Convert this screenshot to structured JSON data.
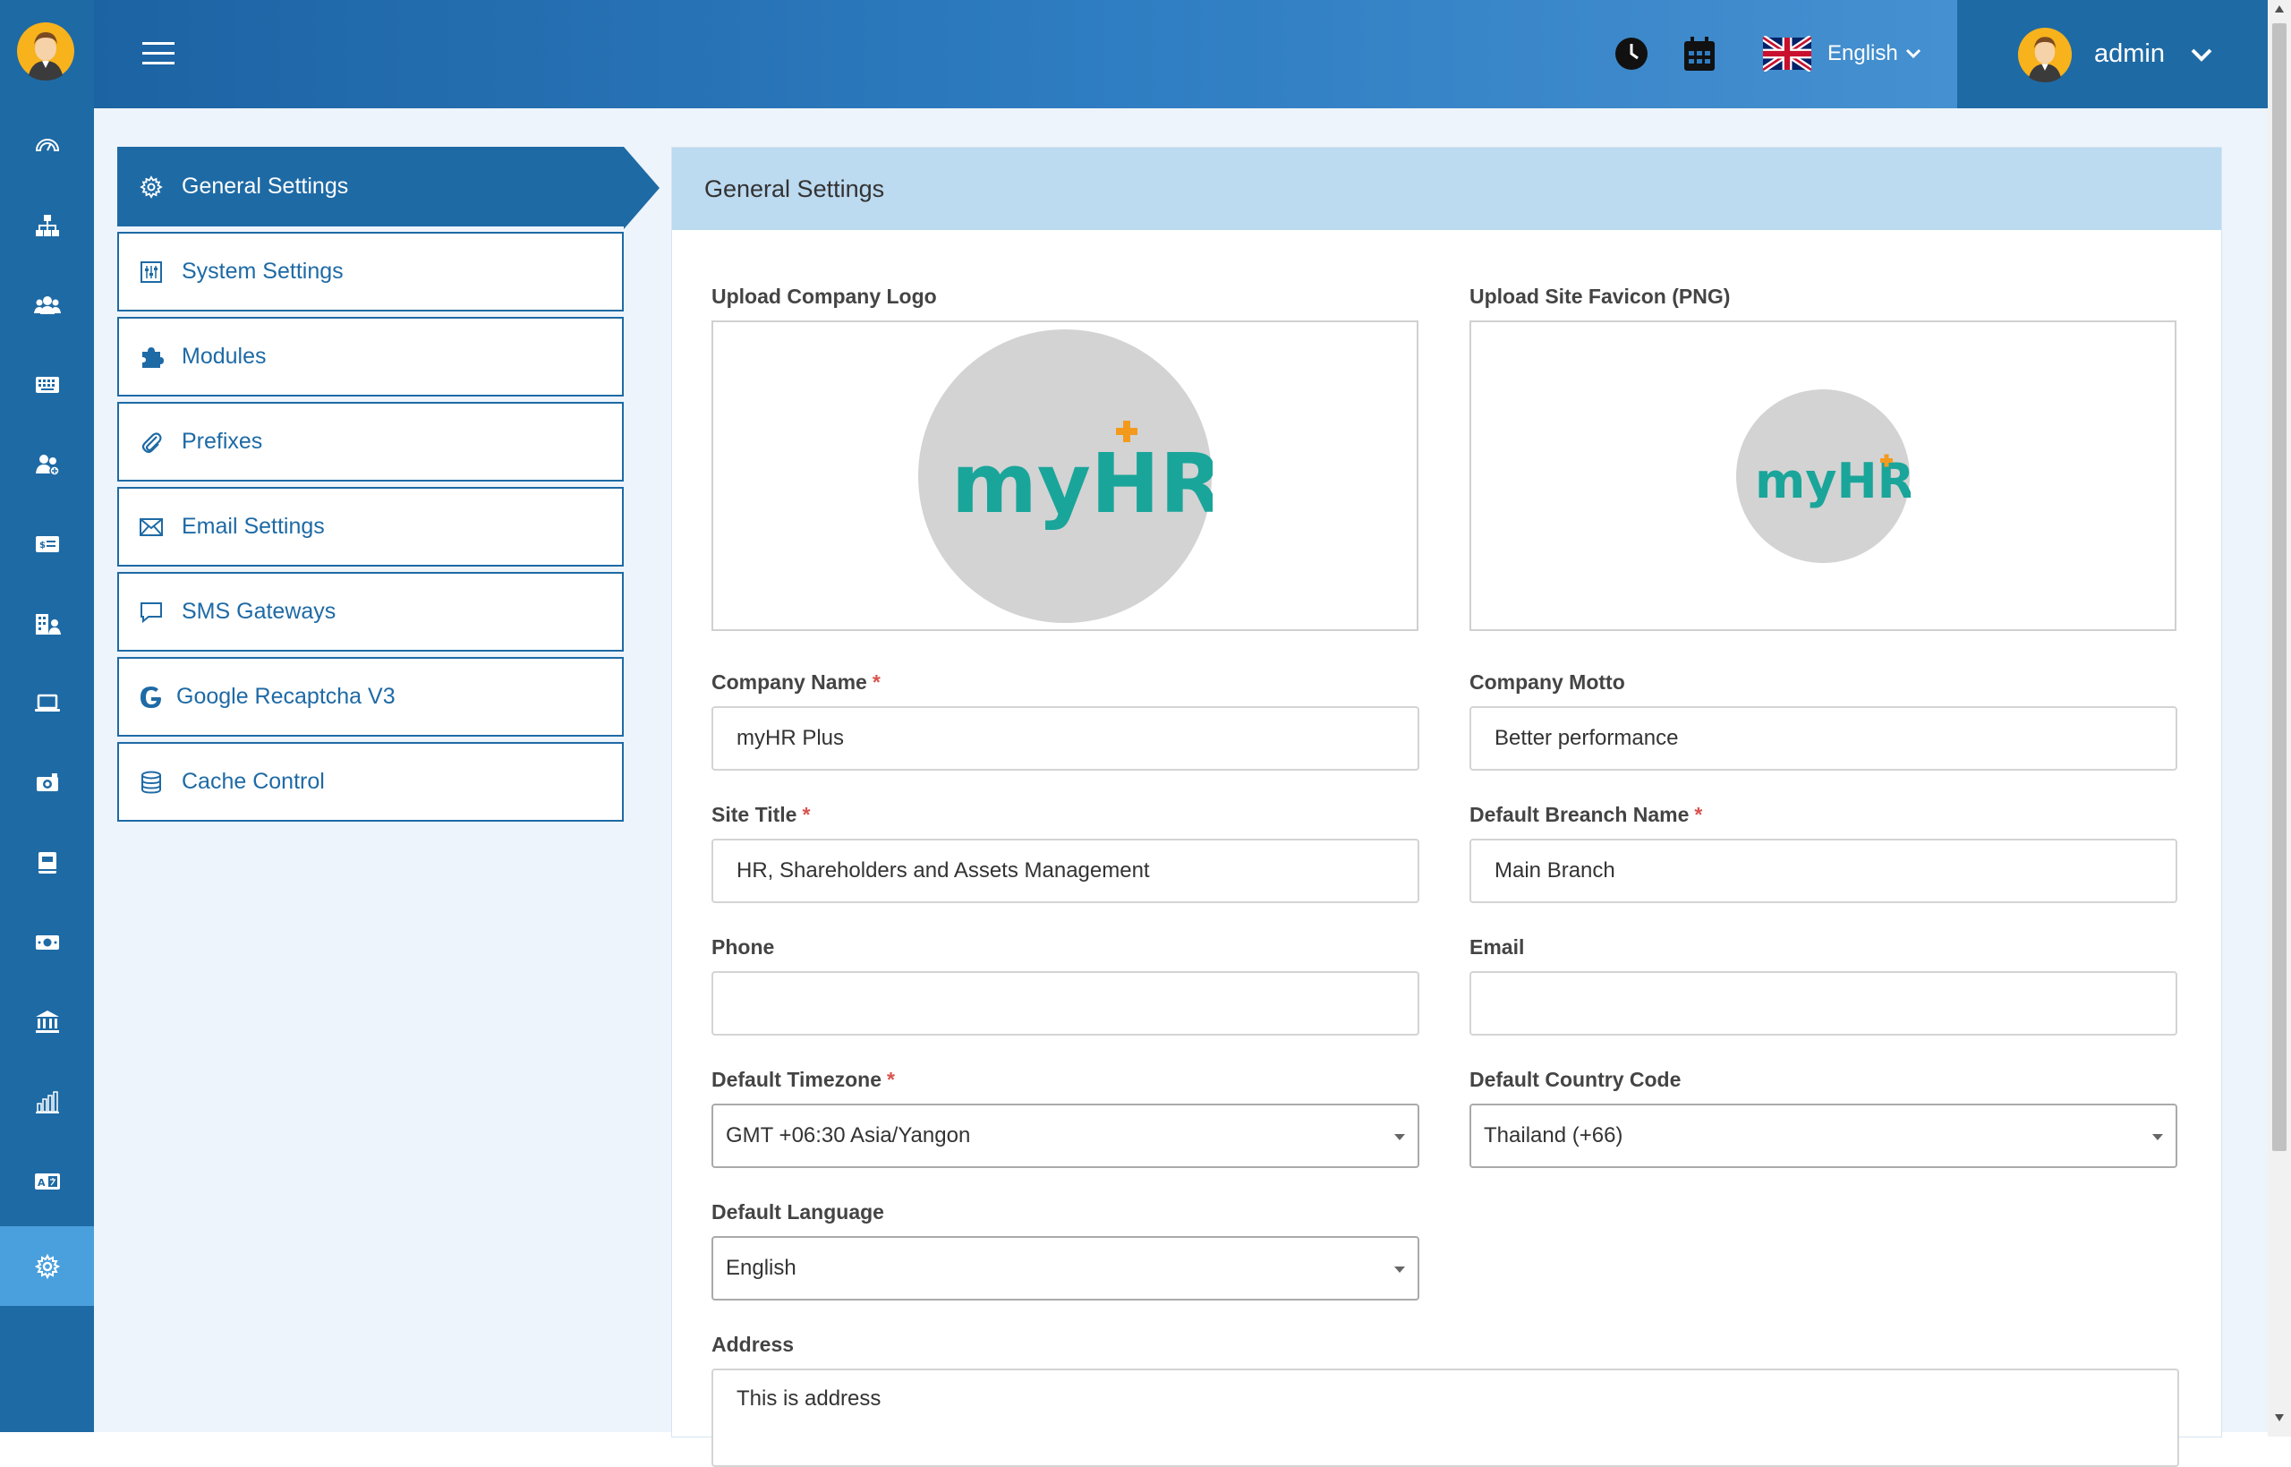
{
  "header": {
    "language": "English",
    "user_name": "admin"
  },
  "sidebar_rail": {
    "icons": [
      "dashboard-icon",
      "org-chart-icon",
      "employees-icon",
      "keyboard-icon",
      "team-icon",
      "id-card-icon",
      "office-icon",
      "laptop-icon",
      "camera-icon",
      "book-icon",
      "money-icon",
      "bank-icon",
      "reports-icon",
      "language-icon",
      "settings-icon"
    ],
    "active": "settings-icon"
  },
  "settings_menu": {
    "items": [
      {
        "label": "General Settings",
        "icon": "gear-icon",
        "active": true
      },
      {
        "label": "System Settings",
        "icon": "sliders-icon",
        "active": false
      },
      {
        "label": "Modules",
        "icon": "puzzle-icon",
        "active": false
      },
      {
        "label": "Prefixes",
        "icon": "paperclip-icon",
        "active": false
      },
      {
        "label": "Email Settings",
        "icon": "envelope-icon",
        "active": false
      },
      {
        "label": "SMS Gateways",
        "icon": "chat-icon",
        "active": false
      },
      {
        "label": "Google Recaptcha V3",
        "icon": "google-icon",
        "active": false
      },
      {
        "label": "Cache Control",
        "icon": "database-icon",
        "active": false
      }
    ]
  },
  "panel": {
    "title": "General Settings",
    "upload_logo_label": "Upload Company Logo",
    "upload_favicon_label": "Upload Site Favicon (PNG)",
    "logo_text": "myHR",
    "company_name": {
      "label": "Company Name",
      "required": "*",
      "value": "myHR Plus"
    },
    "company_motto": {
      "label": "Company Motto",
      "value": "Better performance"
    },
    "site_title": {
      "label": "Site Title",
      "required": "*",
      "value": "HR, Shareholders and Assets Management"
    },
    "default_branch": {
      "label": "Default Breanch Name",
      "required": "*",
      "value": "Main Branch"
    },
    "phone": {
      "label": "Phone",
      "value": ""
    },
    "email": {
      "label": "Email",
      "value": ""
    },
    "timezone": {
      "label": "Default Timezone",
      "required": "*",
      "value": "GMT +06:30 Asia/Yangon"
    },
    "country_code": {
      "label": "Default Country Code",
      "value": "Thailand (+66)"
    },
    "language": {
      "label": "Default Language",
      "value": "English"
    },
    "address": {
      "label": "Address",
      "value": "This is address"
    }
  },
  "colors": {
    "primary": "#1e6aa5",
    "active_rail": "#4aa0dd",
    "panel_header": "#bcdaf0",
    "content_bg": "#edf4fb",
    "required": "#d9534f",
    "logo_teal": "#1aa59a",
    "logo_blue": "#1b73b8",
    "logo_orange": "#f39a1e"
  }
}
